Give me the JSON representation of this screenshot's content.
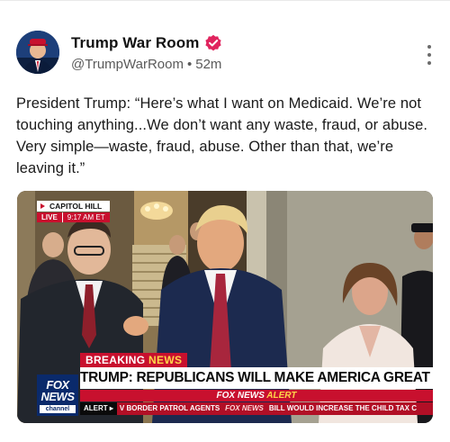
{
  "post": {
    "author": {
      "display_name": "Trump War Room",
      "handle": "@TrumpWarRoom",
      "separator": "•",
      "time_ago": "52m",
      "verified_color": "#e0245e"
    },
    "text": "President Trump: “Here’s what I want on Medicaid. We’re not touching anything...We don’t want any waste, fraud, or abuse. Very simple—waste, fraud, abuse. Other than that, we’re leaving it.”",
    "media": {
      "location_label": "CAPITOL HILL",
      "live_label": "LIVE",
      "time_label": "9:17 AM ET",
      "breaking_label_1": "BREAKING",
      "breaking_label_2": "NEWS",
      "headline": "TRUMP: REPUBLICANS WILL MAKE AMERICA GREAT AGAIN",
      "alert_brand": "FOX NEWS",
      "alert_word": "ALERT",
      "fox_logo_line1": "FOX",
      "fox_logo_line2": "NEWS",
      "fox_logo_line3": "channel",
      "ticker_label": "ALERT ▸",
      "ticker_text_1": "V BORDER PATROL AGENTS",
      "ticker_brand": "FOX NEWS",
      "ticker_text_2": "BILL WOULD INCREASE THE CHILD TAX C"
    }
  }
}
